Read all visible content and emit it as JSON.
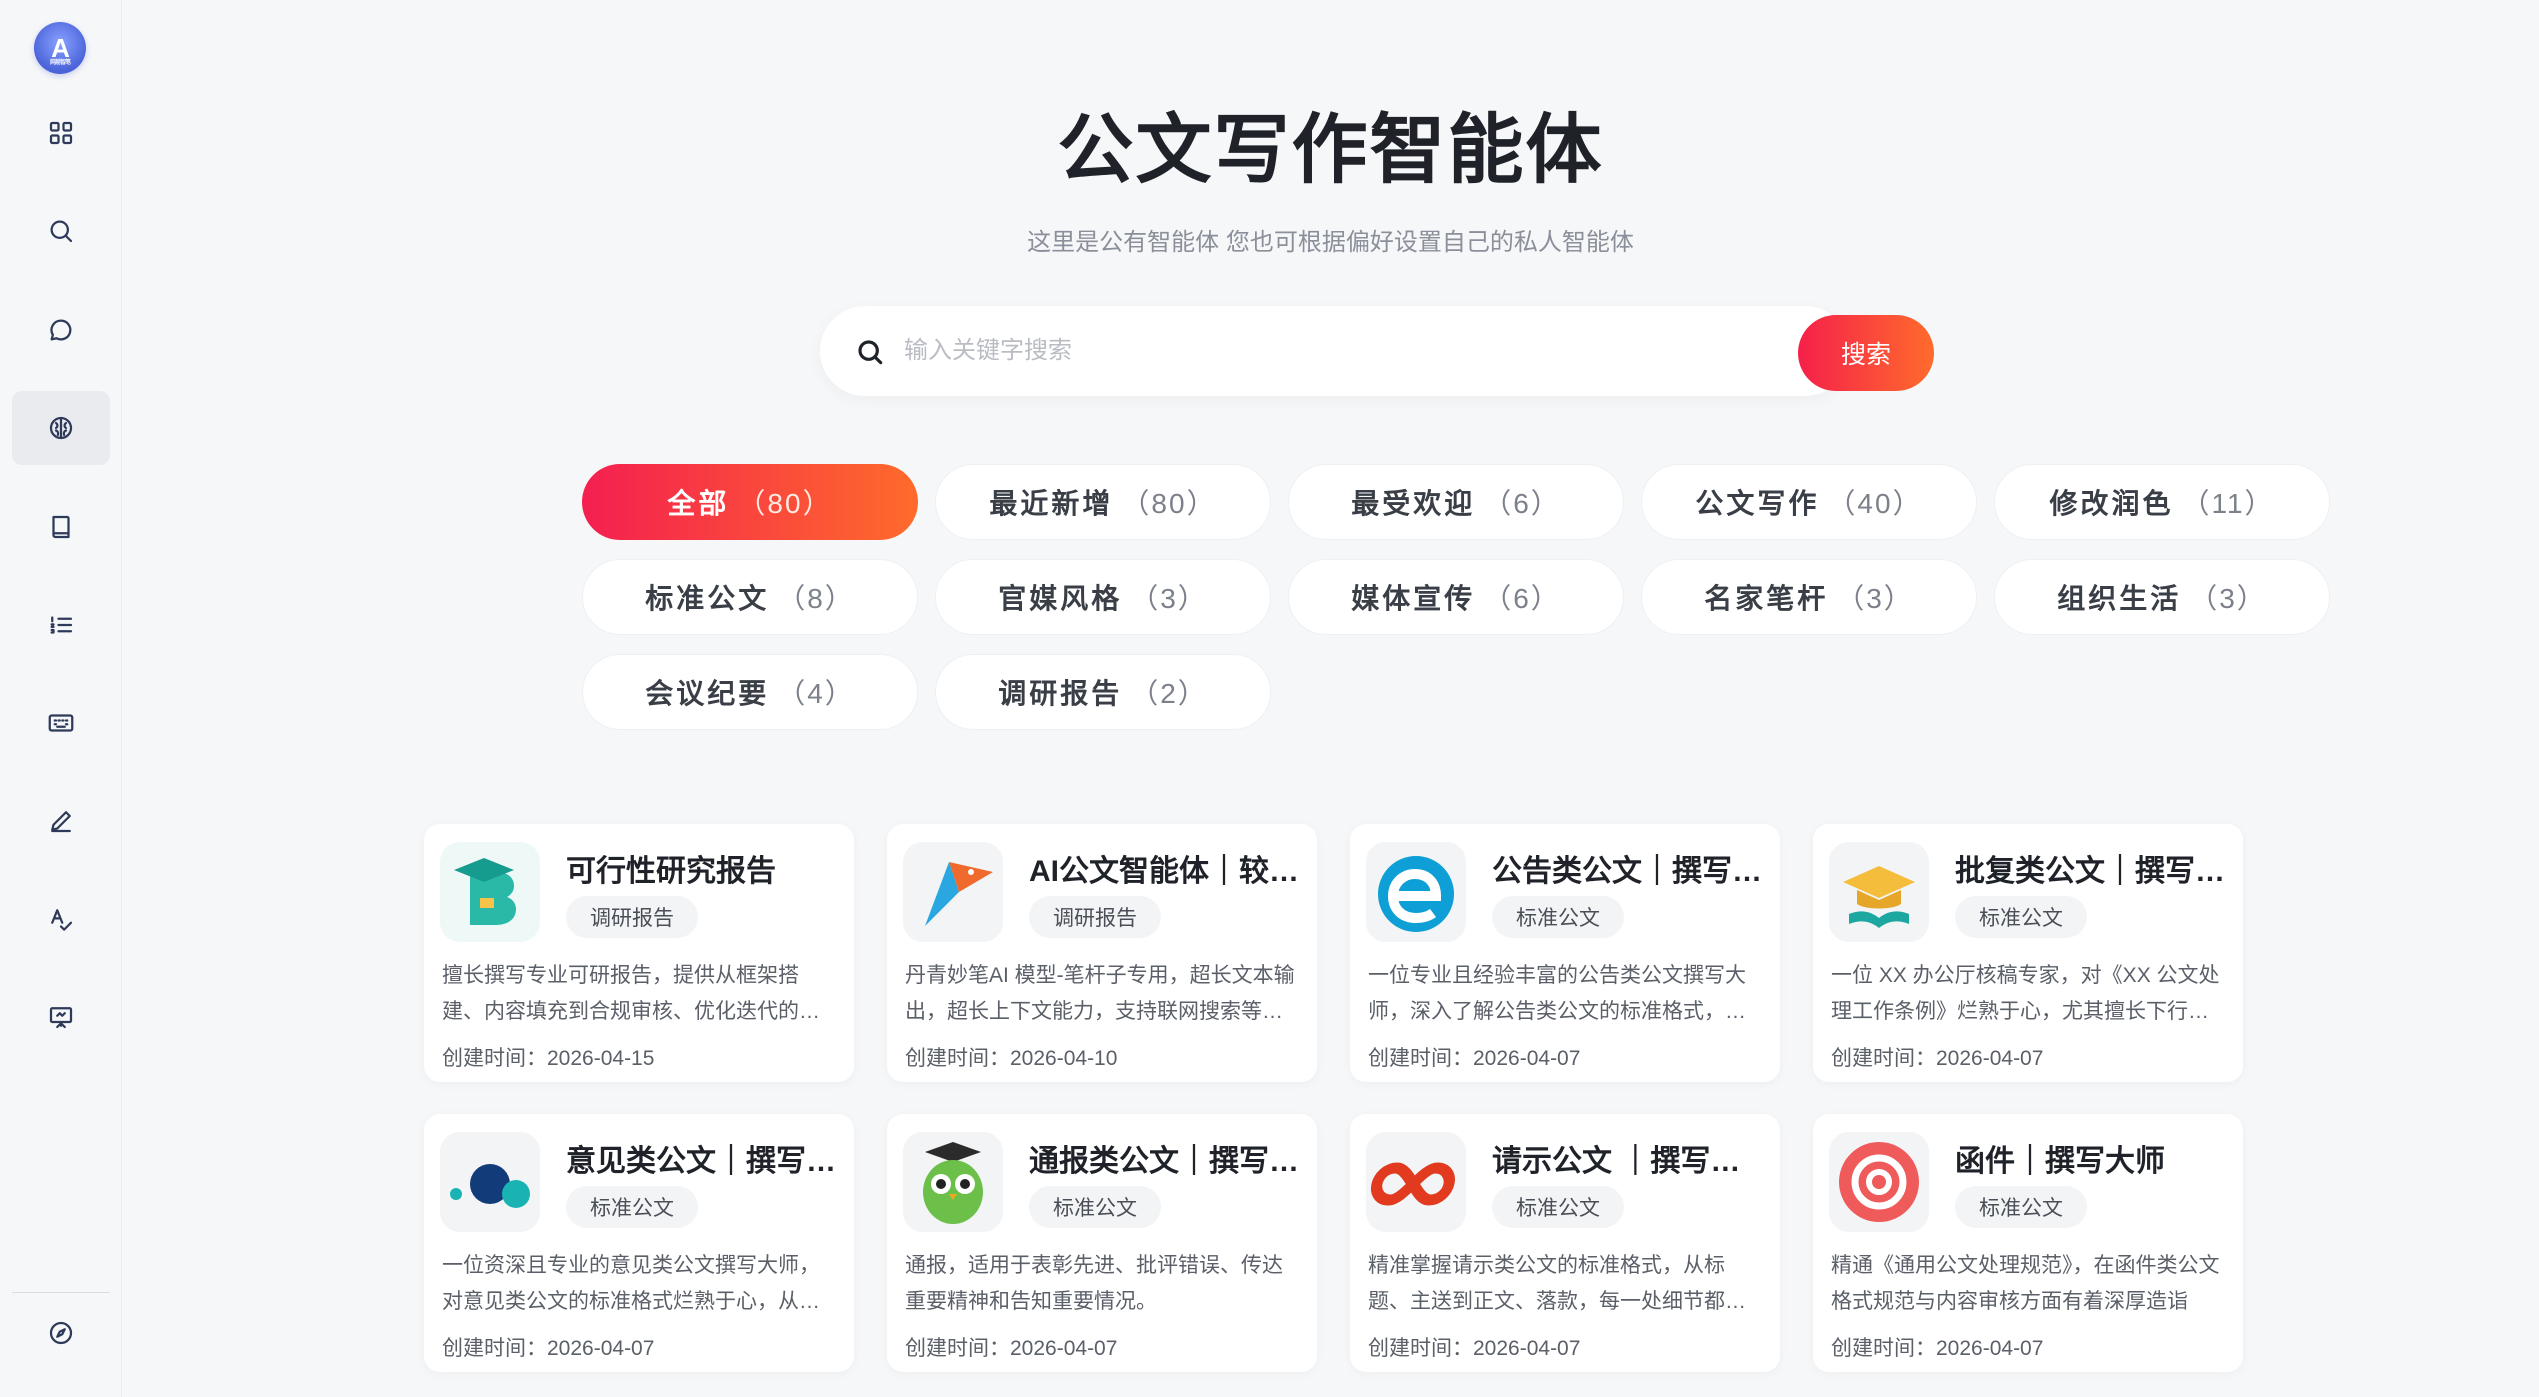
{
  "logo": {
    "text": "A",
    "sub": "网易智笔"
  },
  "header": {
    "title": "公文写作智能体",
    "subtitle": "这里是公有智能体 您也可根据偏好设置自己的私人智能体"
  },
  "search": {
    "placeholder": "输入关键字搜索",
    "button": "搜索"
  },
  "filters": [
    {
      "label": "全部",
      "count": "（80）",
      "active": true
    },
    {
      "label": "最近新增",
      "count": "（80）"
    },
    {
      "label": "最受欢迎",
      "count": "（6）"
    },
    {
      "label": "公文写作",
      "count": "（40）"
    },
    {
      "label": "修改润色",
      "count": "（11）"
    },
    {
      "label": "标准公文",
      "count": "（8）"
    },
    {
      "label": "官媒风格",
      "count": "（3）"
    },
    {
      "label": "媒体宣传",
      "count": "（6）"
    },
    {
      "label": "名家笔杆",
      "count": "（3）"
    },
    {
      "label": "组织生活",
      "count": "（3）"
    },
    {
      "label": "会议纪要",
      "count": "（4）"
    },
    {
      "label": "调研报告",
      "count": "（2）"
    }
  ],
  "cards": [
    {
      "title": "可行性研究报告",
      "tag": "调研报告",
      "desc": "擅长撰写专业可研报告，提供从框架搭建、内容填充到合规审核、优化迭代的全流程服务",
      "date": "创建时间：2026-04-15",
      "icon": "graduation-b-icon"
    },
    {
      "title": "AI公文智能体｜较…",
      "tag": "调研报告",
      "desc": "丹青妙笔AI 模型-笔杆子专用，超长文本输出，超长上下文能力，支持联网搜索等功能",
      "date": "创建时间：2026-04-10",
      "icon": "pen-nib-icon"
    },
    {
      "title": "公告类公文｜撰写…",
      "tag": "标准公文",
      "desc": "一位专业且经验丰富的公告类公文撰写大师，深入了解公告类公文的标准格式，熟悉写作规范",
      "date": "创建时间：2026-04-07",
      "icon": "letter-e-icon"
    },
    {
      "title": "批复类公文｜撰写…",
      "tag": "标准公文",
      "desc": "一位 XX 办公厅核稿专家，对《XX 公文处理工作条例》烂熟于心，尤其擅长下行文写作",
      "date": "创建时间：2026-04-07",
      "icon": "graduation-book-icon"
    },
    {
      "title": "意见类公文｜撰写…",
      "tag": "标准公文",
      "desc": "一位资深且专业的意见类公文撰写大师，对意见类公文的标准格式烂熟于心，从标题到落款",
      "date": "创建时间：2026-04-07",
      "icon": "dots-icon"
    },
    {
      "title": "通报类公文｜撰写…",
      "tag": "标准公文",
      "desc": "通报，适用于表彰先进、批评错误、传达重要精神和告知重要情况。",
      "date": "创建时间：2026-04-07",
      "icon": "owl-icon"
    },
    {
      "title": "请示公文 ｜撰写大师",
      "tag": "标准公文",
      "desc": "精准掌握请示类公文的标准格式，从标题、主送到正文、落款，每一处细节都严格把关",
      "date": "创建时间：2026-04-07",
      "icon": "infinity-icon"
    },
    {
      "title": "函件｜撰写大师",
      "tag": "标准公文",
      "desc": "精通《通用公文处理规范》，在函件类公文格式规范与内容审核方面有着深厚造诣",
      "date": "创建时间：2026-04-07",
      "icon": "target-icon"
    }
  ],
  "colors": {
    "accent_start": "#f41f50",
    "accent_end": "#ff6b2b"
  }
}
